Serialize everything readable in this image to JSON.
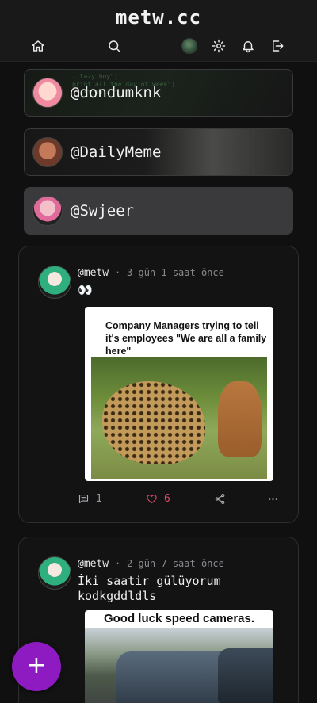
{
  "app": {
    "title": "metw.cc"
  },
  "nav": {
    "icons": [
      "home-icon",
      "search-icon",
      "avatar",
      "gear-icon",
      "bell-icon",
      "logout-icon"
    ]
  },
  "users": [
    {
      "handle": "@dondumknk",
      "code_snippet": "… lazy boy\")\nprint all the day of week\")\n… ist Nota \")"
    },
    {
      "handle": "@DailyMeme"
    },
    {
      "handle": "@Swjeer"
    }
  ],
  "posts": [
    {
      "author": "@metw",
      "separator": "·",
      "time": "3 gün 1 saat önce",
      "text": "👀",
      "image_caption": "Company Managers trying to tell it's employees \"We are all a family here\"",
      "comments": "1",
      "likes": "6"
    },
    {
      "author": "@metw",
      "separator": "·",
      "time": "2 gün 7 saat önce",
      "text": "İki saatir gülüyorum kodkgddldls",
      "image_caption": "Good luck speed cameras."
    }
  ],
  "fab": {
    "label": "+"
  },
  "colors": {
    "accent": "#8e1bc1",
    "like": "#e0486a",
    "background": "#101011"
  }
}
